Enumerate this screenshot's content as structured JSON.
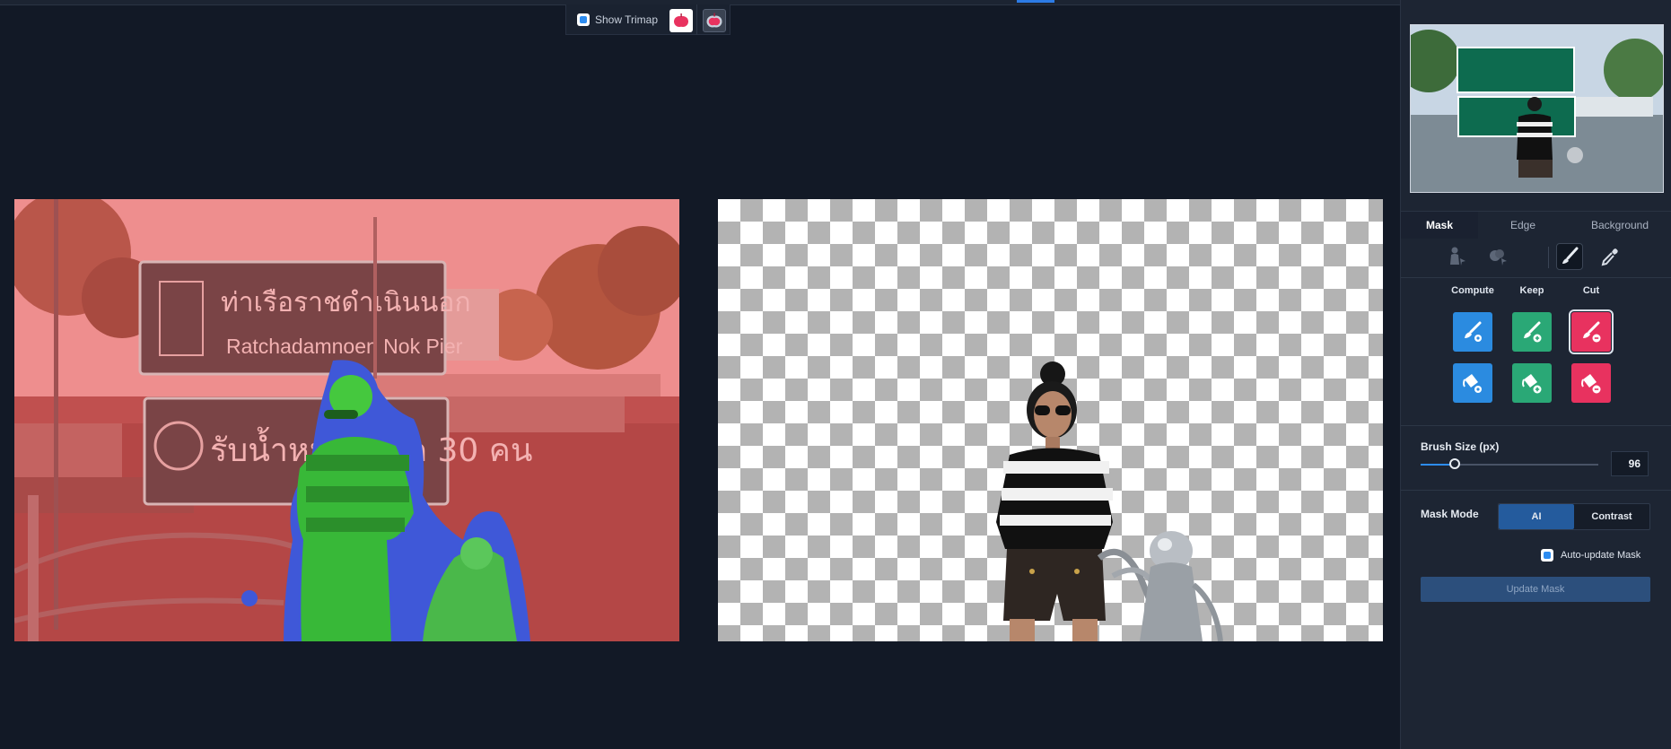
{
  "trimap": {
    "show_trimap_label": "Show Trimap",
    "checked": true,
    "icon1": "apple-mask-icon",
    "icon2": "apple-trimap-icon"
  },
  "canvas": {
    "left_view": "trimap-overlay",
    "right_view": "transparent-result"
  },
  "photo": {
    "sign_top_thai": "ท่าเรือราชดำเนินนอก",
    "sign_top_en": "Ratchadamnoen Nok Pier",
    "sign_bottom_thai": "รับน้ำหนักสูงสุด 30 คน"
  },
  "sidebar": {
    "tabs": [
      "Mask",
      "Edge",
      "Background"
    ],
    "active_tab": "Mask",
    "tools": [
      "person-select-icon",
      "object-select-icon",
      "brush-icon",
      "eyedropper-icon"
    ],
    "active_tool": "brush-icon",
    "columns": [
      "Compute",
      "Keep",
      "Cut"
    ],
    "selected_tool_button": "cut-brush",
    "brush_size": {
      "label": "Brush Size (px)",
      "value": "96",
      "slider_fraction": 0.19
    },
    "mask_mode": {
      "label": "Mask Mode",
      "options": [
        "AI",
        "Contrast"
      ],
      "active": "AI"
    },
    "auto_update": {
      "label": "Auto-update Mask",
      "checked": true
    },
    "update_button": "Update Mask"
  },
  "colors": {
    "compute": "#2b8be0",
    "keep": "#2aa876",
    "cut": "#e8325f",
    "accent": "#2d8cf0"
  }
}
